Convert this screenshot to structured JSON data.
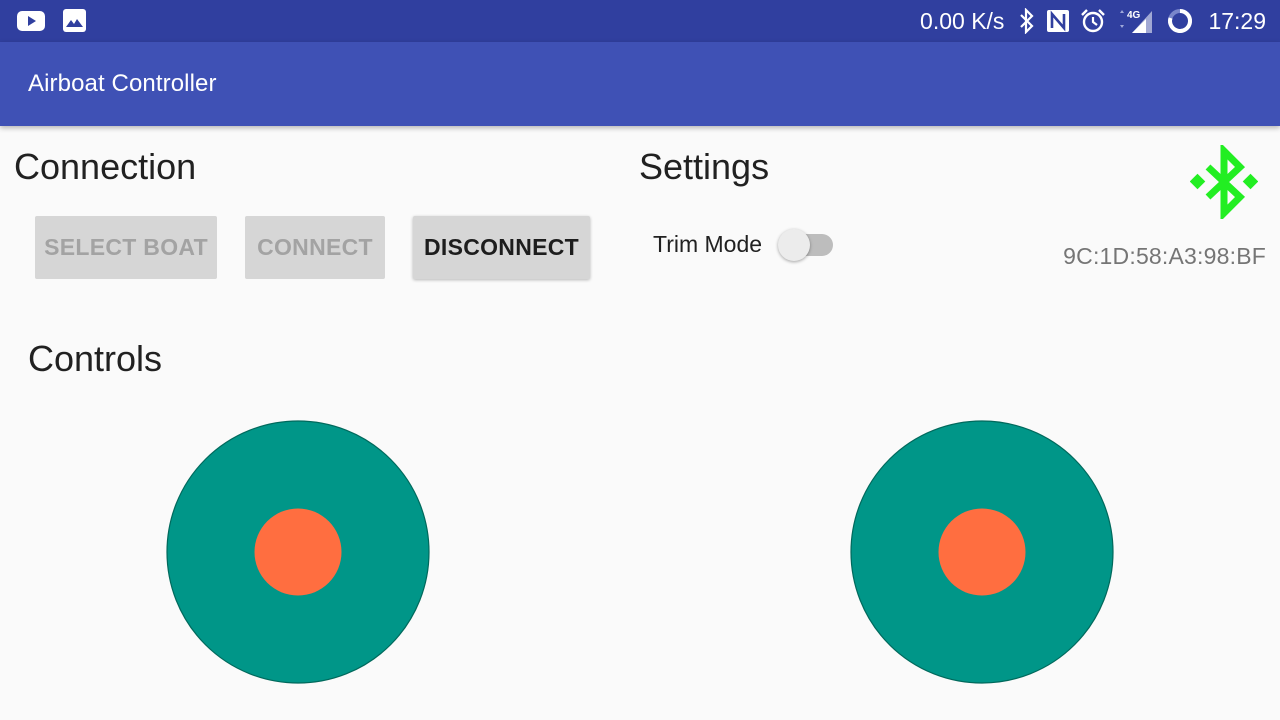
{
  "status_bar": {
    "left_icons": [
      "youtube-icon",
      "gallery-icon"
    ],
    "network_speed": "0.00 K/s",
    "network_type": "4G",
    "right_icons": [
      "bluetooth-icon",
      "nfc-icon",
      "alarm-icon",
      "data-arrows-icon",
      "signal-icon",
      "battery-ring-icon"
    ],
    "time": "17:29"
  },
  "app_bar": {
    "title": "Airboat Controller",
    "color": "#3f51b5"
  },
  "connection": {
    "title": "Connection",
    "buttons": [
      {
        "label": "SELECT BOAT",
        "enabled": false
      },
      {
        "label": "CONNECT",
        "enabled": false
      },
      {
        "label": "DISCONNECT",
        "enabled": true
      }
    ]
  },
  "settings": {
    "title": "Settings",
    "trim_mode": {
      "label": "Trim Mode",
      "checked": false
    }
  },
  "bluetooth": {
    "icon": "bluetooth-connected-icon",
    "status_color": "#22ee22",
    "mac_address": "9C:1D:58:A3:98:BF"
  },
  "controls": {
    "title": "Controls",
    "joysticks": [
      {
        "name": "left",
        "base_color": "#009688",
        "knob_color": "#ff6e40",
        "x": 0,
        "y": 0
      },
      {
        "name": "right",
        "base_color": "#009688",
        "knob_color": "#ff6e40",
        "x": 0,
        "y": 0
      }
    ]
  }
}
